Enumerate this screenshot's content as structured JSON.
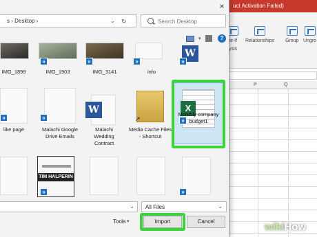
{
  "excel": {
    "title_fragment": "uct Activation Failed)",
    "ribbon": [
      {
        "label": "at-If",
        "icon": "what-if-icon"
      },
      {
        "label": "Relationships",
        "icon": "relationships-icon"
      },
      {
        "label": "Group",
        "icon": "group-icon"
      },
      {
        "label": "Ungro",
        "icon": "ungroup-icon"
      }
    ],
    "ribbon_sub": "ysis",
    "columns": [
      "P",
      "Q"
    ]
  },
  "dialog": {
    "close_label": "×",
    "breadcrumb": "s › Desktop ›",
    "search_placeholder": "Search Desktop",
    "files_row1": [
      "IMG_1899",
      "IMG_1903",
      "IMG_3141",
      "info",
      ""
    ],
    "files_row2": [
      {
        "name": "like page",
        "type": "doc"
      },
      {
        "name": "Malachi Google Drive Emails",
        "type": "doc"
      },
      {
        "name": "Malachi Wedding Contract",
        "type": "word"
      },
      {
        "name": "Media Cache Files - Shortcut",
        "type": "folder"
      },
      {
        "name": "Monthly company budget1",
        "type": "excel"
      }
    ],
    "tim_tile_name": "TIM HALPERIN",
    "filter": "All Files",
    "tools_label": "Tools",
    "import_label": "Import",
    "cancel_label": "Cancel"
  },
  "watermark": {
    "wiki": "wiki",
    "how": "How"
  },
  "colors": {
    "highlight": "#3bd23b",
    "excel_green": "#1d6f42",
    "word_blue": "#2b579a",
    "title_red": "#c7392b"
  }
}
